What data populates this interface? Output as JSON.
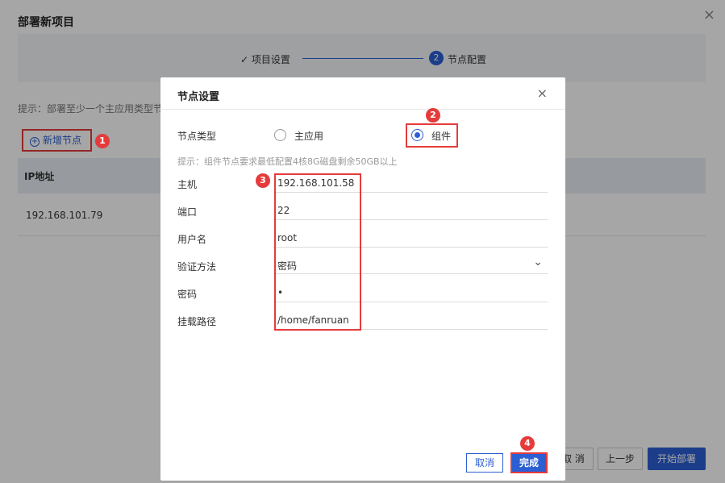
{
  "background": {
    "title": "部署新项目",
    "close": "×",
    "steps": [
      {
        "label": "✓ 项目设置"
      },
      {
        "num": "2",
        "label": "节点配置"
      }
    ],
    "hint": "提示：部署至少一个主应用类型节",
    "add_node_label": "新增节点",
    "table": {
      "header": "IP地址",
      "row_ip": "192.168.101.79"
    },
    "buttons": {
      "cancel": "取 消",
      "prev": "上一步",
      "start": "开始部署"
    }
  },
  "badges": [
    "1",
    "2",
    "3",
    "4"
  ],
  "modal": {
    "title": "节点设置",
    "close": "×",
    "node_type_label": "节点类型",
    "options": {
      "main_app": "主应用",
      "component": "组件",
      "selected": "组件"
    },
    "tip": "提示：组件节点要求最低配置4核8G磁盘剩余50GB以上",
    "fields": [
      {
        "label": "主机",
        "value": "192.168.101.58"
      },
      {
        "label": "端口",
        "value": "22"
      },
      {
        "label": "用户名",
        "value": "root"
      },
      {
        "label": "验证方法",
        "value": "密码"
      },
      {
        "label": "密码",
        "value": "•"
      },
      {
        "label": "挂载路径",
        "value": "/home/fanruan"
      }
    ],
    "buttons": {
      "cancel": "取消",
      "done": "完成"
    }
  },
  "colors": {
    "accent": "#2c5fd3",
    "highlight": "#e53b3b"
  }
}
